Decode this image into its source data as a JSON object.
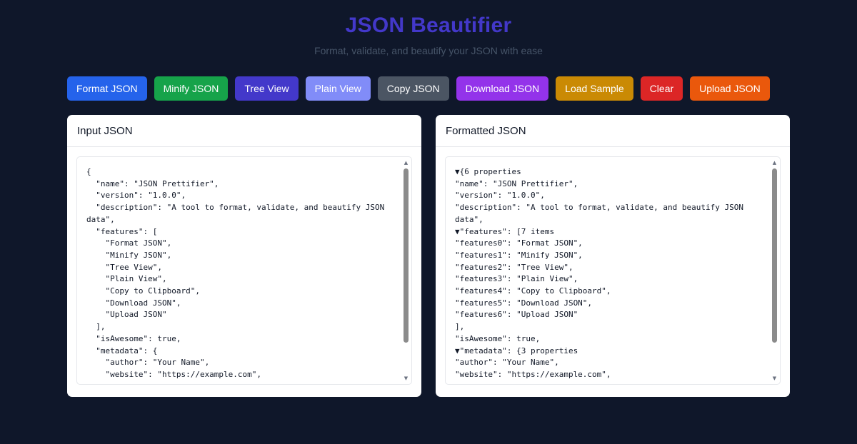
{
  "header": {
    "title": "JSON Beautifier",
    "subtitle": "Format, validate, and beautify your JSON with ease"
  },
  "toolbar": {
    "buttons": [
      {
        "label": "Format JSON",
        "color": "#2563eb"
      },
      {
        "label": "Minify JSON",
        "color": "#16a34a"
      },
      {
        "label": "Tree View",
        "color": "#4338ca"
      },
      {
        "label": "Plain View",
        "color": "#818cf8"
      },
      {
        "label": "Copy JSON",
        "color": "#4b5563"
      },
      {
        "label": "Download JSON",
        "color": "#9333ea"
      },
      {
        "label": "Load Sample",
        "color": "#ca8a04"
      },
      {
        "label": "Clear",
        "color": "#dc2626"
      },
      {
        "label": "Upload JSON",
        "color": "#ea580c"
      }
    ]
  },
  "input_panel": {
    "title": "Input JSON",
    "lines": [
      "{",
      "  \"name\": \"JSON Prettifier\",",
      "  \"version\": \"1.0.0\",",
      "  \"description\": \"A tool to format, validate, and beautify JSON",
      "data\",",
      "  \"features\": [",
      "    \"Format JSON\",",
      "    \"Minify JSON\",",
      "    \"Tree View\",",
      "    \"Plain View\",",
      "    \"Copy to Clipboard\",",
      "    \"Download JSON\",",
      "    \"Upload JSON\"",
      "  ],",
      "  \"isAwesome\": true,",
      "  \"metadata\": {",
      "    \"author\": \"Your Name\",",
      "    \"website\": \"https://example.com\","
    ]
  },
  "output_panel": {
    "title": "Formatted JSON",
    "lines": [
      "▼{6 properties",
      "\"name\": \"JSON Prettifier\",",
      "\"version\": \"1.0.0\",",
      "\"description\": \"A tool to format, validate, and beautify JSON",
      "data\",",
      "▼\"features\": [7 items",
      "\"features0\": \"Format JSON\",",
      "\"features1\": \"Minify JSON\",",
      "\"features2\": \"Tree View\",",
      "\"features3\": \"Plain View\",",
      "\"features4\": \"Copy to Clipboard\",",
      "\"features5\": \"Download JSON\",",
      "\"features6\": \"Upload JSON\"",
      "],",
      "\"isAwesome\": true,",
      "▼\"metadata\": {3 properties",
      "\"author\": \"Your Name\",",
      "\"website\": \"https://example.com\","
    ]
  }
}
